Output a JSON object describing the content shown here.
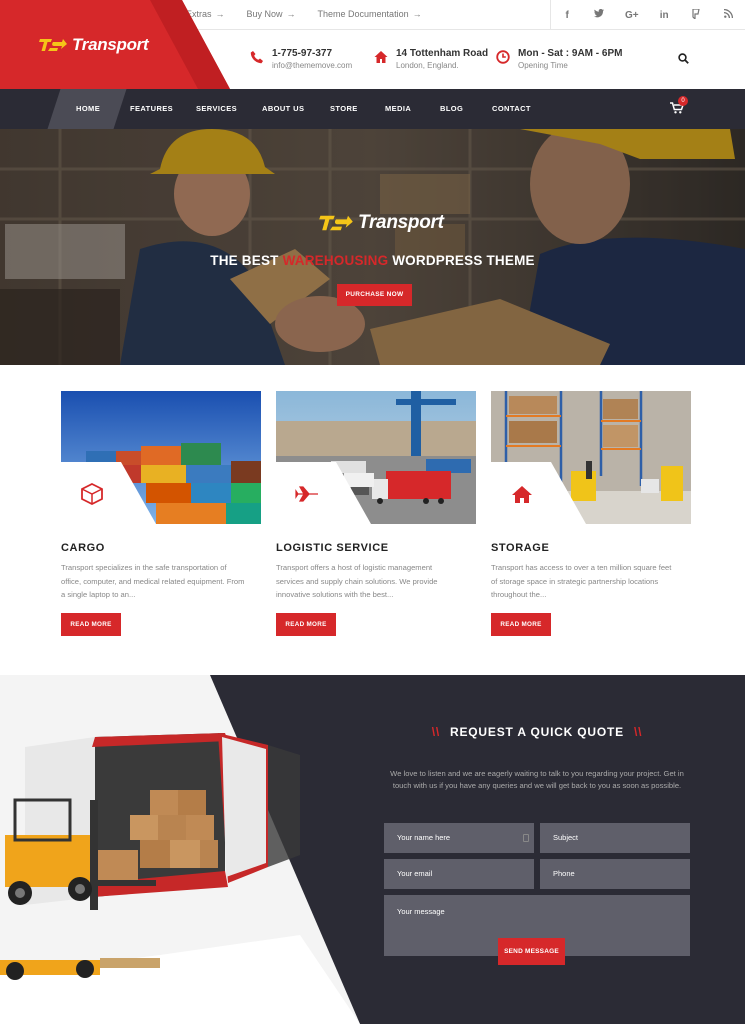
{
  "colors": {
    "accent": "#d6282a",
    "dark": "#2b2b35",
    "field": "#5f5f6a"
  },
  "topbar": {
    "links": [
      {
        "label": "Extras"
      },
      {
        "label": "Buy Now"
      },
      {
        "label": "Theme Documentation"
      }
    ],
    "social_icons": [
      "facebook-icon",
      "twitter-icon",
      "google-plus-icon",
      "linkedin-icon",
      "foursquare-icon",
      "rss-icon"
    ]
  },
  "brand": {
    "name": "Transport",
    "mark": "TS"
  },
  "contact": {
    "phone": {
      "line1": "1-775-97-377",
      "line2": "info@thememove.com"
    },
    "address": {
      "line1": "14 Tottenham Road",
      "line2": "London, England."
    },
    "hours": {
      "line1": "Mon - Sat : 9AM - 6PM",
      "line2": "Opening Time"
    }
  },
  "nav": {
    "items": [
      "HOME",
      "FEATURES",
      "SERVICES",
      "ABOUT US",
      "STORE",
      "MEDIA",
      "BLOG",
      "CONTACT"
    ],
    "cart_count": "0"
  },
  "hero": {
    "brand": "Transport",
    "title_pre": "THE BEST ",
    "title_highlight": "WAREHOUSING",
    "title_post": " WORDPRESS THEME",
    "button": "PURCHASE NOW"
  },
  "services": [
    {
      "title": "CARGO",
      "desc": "Transport specializes in the safe transportation of office, computer, and medical related equipment. From a single laptop to an...",
      "button": "READ MORE",
      "icon": "cube-icon"
    },
    {
      "title": "LOGISTIC SERVICE",
      "desc": "Transport offers a host of logistic management services and supply chain solutions. We provide innovative solutions with the best...",
      "button": "READ MORE",
      "icon": "plane-icon"
    },
    {
      "title": "STORAGE",
      "desc": "Transport has access to over a ten million square feet of storage space in strategic partnership locations throughout the...",
      "button": "READ MORE",
      "icon": "home-icon"
    }
  ],
  "quote": {
    "title": "REQUEST A QUICK QUOTE",
    "slash": "\\\\",
    "desc": "We love to listen and we are eagerly waiting to talk to you regarding your project. Get in touch with us if you have any queries and we will get back to you as soon as possible.",
    "fields": {
      "name": "Your name here",
      "subject": "Subject",
      "email": "Your email",
      "phone": "Phone",
      "message": "Your message"
    },
    "button": "SEND MESSAGE"
  }
}
